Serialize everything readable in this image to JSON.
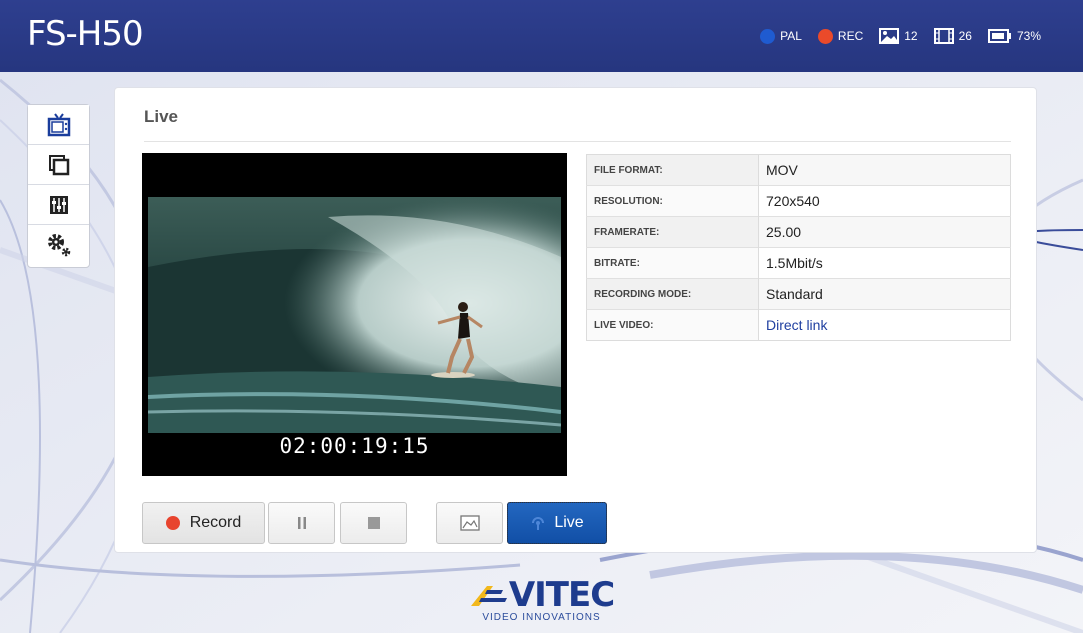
{
  "header": {
    "title": "FS-H50",
    "status": {
      "video_standard": "PAL",
      "rec_label": "REC",
      "pictures_count": "12",
      "clips_count": "26",
      "battery": "73%"
    }
  },
  "nav": {
    "items": [
      {
        "id": "live",
        "icon": "tv-icon",
        "active": true
      },
      {
        "id": "clips",
        "icon": "clips-icon"
      },
      {
        "id": "settings",
        "icon": "mixer-icon"
      },
      {
        "id": "system",
        "icon": "gears-icon"
      }
    ]
  },
  "panel": {
    "title": "Live",
    "timecode": "02:00:19:15",
    "info": [
      {
        "label": "FILE FORMAT:",
        "value": "MOV"
      },
      {
        "label": "RESOLUTION:",
        "value": "720x540"
      },
      {
        "label": "FRAMERATE:",
        "value": "25.00"
      },
      {
        "label": "BITRATE:",
        "value": "1.5Mbit/s"
      },
      {
        "label": "RECORDING MODE:",
        "value": "Standard"
      },
      {
        "label": "LIVE VIDEO:",
        "value": "Direct link"
      }
    ]
  },
  "controls": {
    "record_label": "Record",
    "live_label": "Live"
  },
  "footer": {
    "brand": "VITEC",
    "tagline": "VIDEO INNOVATIONS"
  },
  "colors": {
    "header": "#2a3b88",
    "pal_dot": "#1f5bd0",
    "rec_dot": "#ea4a2a",
    "live_button": "#1a5cb5"
  }
}
